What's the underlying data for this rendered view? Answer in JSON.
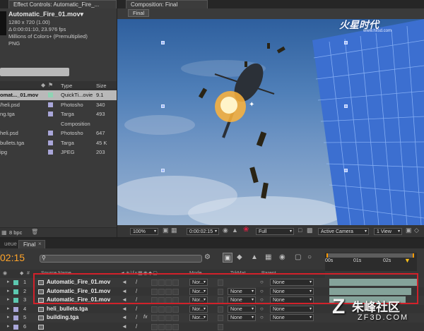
{
  "effect_controls": {
    "tab_label": "Effect Controls: Automatic_Fire_..."
  },
  "project": {
    "item_name": "Automatic_Fire_01.mov▾",
    "resolution": "1280 x 720 (1.00)",
    "duration_fps": "Δ 0:00:01:10, 23.976 fps",
    "colors": "Millions of Colors+ (Premultiplied)",
    "codec": "PNG",
    "columns": {
      "type": "Type",
      "size": "Size"
    },
    "rows": [
      {
        "name": "omat..._01.mov",
        "color": "#8fd4b4",
        "type": "QuickTi...ovie",
        "size": "9.1",
        "selected": true
      },
      {
        "name": "/heli.psd",
        "color": "#a9a6d9",
        "type": "Photosho",
        "size": "340",
        "selected": false
      },
      {
        "name": "ng.tga",
        "color": "#a9a6d9",
        "type": "Targa",
        "size": "493",
        "selected": false
      },
      {
        "name": "",
        "color": "#3a3a3a",
        "type": "Composition",
        "size": "",
        "selected": false
      },
      {
        "name": "heli.psd",
        "color": "#a9a6d9",
        "type": "Photosho",
        "size": "647",
        "selected": false
      },
      {
        "name": "bullets.tga",
        "color": "#a9a6d9",
        "type": "Targa",
        "size": "45 K",
        "selected": false
      },
      {
        "name": "ipg",
        "color": "#a9a6d9",
        "type": "JPEG",
        "size": "203",
        "selected": false
      }
    ],
    "bpc": "8 bpc"
  },
  "composition": {
    "tab_label": "Composition: Final",
    "flow_label": "Final",
    "watermark_top": "火星时代",
    "watermark_top_url": "www.hxsd.com",
    "zoom": "100%",
    "timecode": "0:00:02:15",
    "resolution": "Full",
    "camera": "Active Camera",
    "views": "1 View"
  },
  "timeline": {
    "tabs": [
      "ueue",
      "Final"
    ],
    "current_time": "02:15",
    "ruler_ticks": [
      "00s",
      "01s",
      "02s"
    ],
    "headers": {
      "source_name": "Source Name",
      "mode": "Mode",
      "trkmat": "TrkMat",
      "parent": "Parent"
    },
    "layers": [
      {
        "num": "1",
        "name": "Automatic_Fire_01.mov",
        "color": "#5cc8b0",
        "mode": "Nor...",
        "trkmat": "",
        "parent": "None",
        "bar": true
      },
      {
        "num": "2",
        "name": "Automatic_Fire_01.mov",
        "color": "#5cc8b0",
        "mode": "Nor...",
        "trkmat": "None",
        "parent": "None",
        "bar": true
      },
      {
        "num": "3",
        "name": "Automatic_Fire_01.mov",
        "color": "#5cc8b0",
        "mode": "Nor...",
        "trkmat": "None",
        "parent": "None",
        "bar": true
      },
      {
        "num": "4",
        "name": "heli_bullets.tga",
        "color": "#a9a6d9",
        "mode": "Nor...",
        "trkmat": "None",
        "parent": "None",
        "bar": false
      },
      {
        "num": "5",
        "name": "building.tga",
        "color": "#a9a6d9",
        "mode": "Nor...",
        "trkmat": "None",
        "parent": "None",
        "bar": false
      },
      {
        "num": "6",
        "name": "",
        "color": "#a9a6d9",
        "mode": "",
        "trkmat": "",
        "parent": "",
        "bar": false
      }
    ]
  },
  "watermark_bottom": {
    "text": "朱峰社区",
    "url": "ZF3D.COM"
  },
  "colors": {
    "accent": "#ff9a00",
    "highlight": "#d2212a",
    "timecode": "#ffa42a"
  }
}
